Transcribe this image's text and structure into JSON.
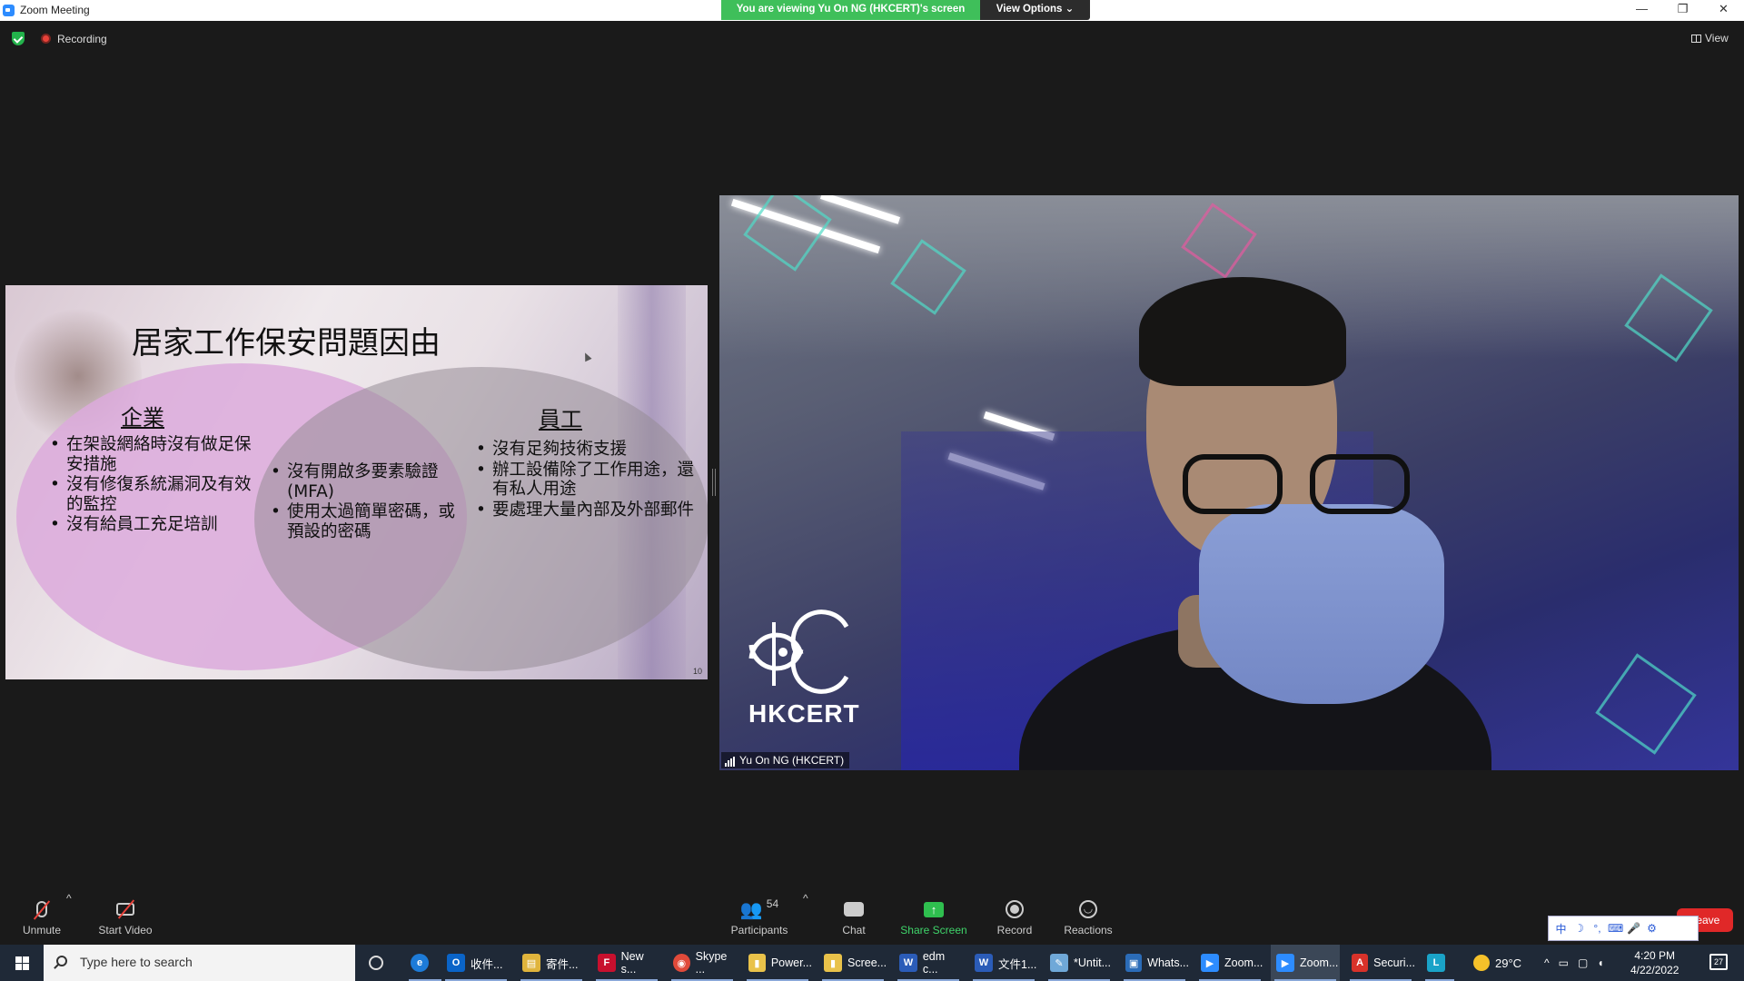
{
  "window": {
    "title": "Zoom Meeting",
    "viewing_banner": "You are viewing Yu On NG (HKCERT)'s screen",
    "view_options": "View Options ⌄",
    "minimize": "—",
    "restore": "❐",
    "close": "✕"
  },
  "overlay": {
    "recording_label": "Recording",
    "view_label": "View"
  },
  "slide": {
    "title": "居家工作保安問題因由",
    "left_title": "企業",
    "right_title": "員工",
    "left_bullets": [
      "在架設網絡時沒有做足保安措施",
      "沒有修復系統漏洞及有效的監控",
      "沒有給員工充足培訓"
    ],
    "middle_bullets": [
      "沒有開啟多要素驗證(MFA)",
      "使用太過簡單密碼，或預設的密碼"
    ],
    "right_bullets": [
      "沒有足夠技術支援",
      "辦工設備除了工作用途，還有私人用途",
      "要處理大量內部及外部郵件"
    ],
    "page_number": "10"
  },
  "video": {
    "participant_name": "Yu On NG (HKCERT)",
    "logo_text": "HKCERT"
  },
  "controls": {
    "unmute": "Unmute",
    "start_video": "Start Video",
    "participants": "Participants",
    "participants_count": "54",
    "chat": "Chat",
    "share_screen": "Share Screen",
    "record": "Record",
    "reactions": "Reactions",
    "leave": "Leave",
    "caret": "^"
  },
  "ime": {
    "items": [
      "中",
      "☽",
      "°,",
      "⌨",
      "🎤",
      "⚙"
    ]
  },
  "taskbar": {
    "search_placeholder": "Type here to search",
    "items": [
      {
        "label": "收件...",
        "icon": "O",
        "color": "#0a64c8"
      },
      {
        "label": "寄件...",
        "icon": "▤",
        "color": "#e0b43c"
      },
      {
        "label": "New s...",
        "icon": "F",
        "color": "#c8102e"
      },
      {
        "label": "Skype ...",
        "icon": "◉",
        "color": "#e04a3a"
      },
      {
        "label": "Power...",
        "icon": "▮",
        "color": "#e9c24a"
      },
      {
        "label": "Scree...",
        "icon": "▮",
        "color": "#e9c24a"
      },
      {
        "label": "edm c...",
        "icon": "W",
        "color": "#2b5cb8"
      },
      {
        "label": "文件1...",
        "icon": "W",
        "color": "#2b5cb8"
      },
      {
        "label": "*Untit...",
        "icon": "✎",
        "color": "#6fa8d8"
      },
      {
        "label": "Whats...",
        "icon": "▣",
        "color": "#2b6cb8"
      },
      {
        "label": "Zoom...",
        "icon": "▶",
        "color": "#2d8cff"
      },
      {
        "label": "Zoom...",
        "icon": "▶",
        "color": "#2d8cff"
      },
      {
        "label": "Securi...",
        "icon": "A",
        "color": "#d8322a"
      }
    ],
    "temperature": "29°C",
    "time": "4:20 PM",
    "date": "4/22/2022",
    "notification_count": "27"
  }
}
